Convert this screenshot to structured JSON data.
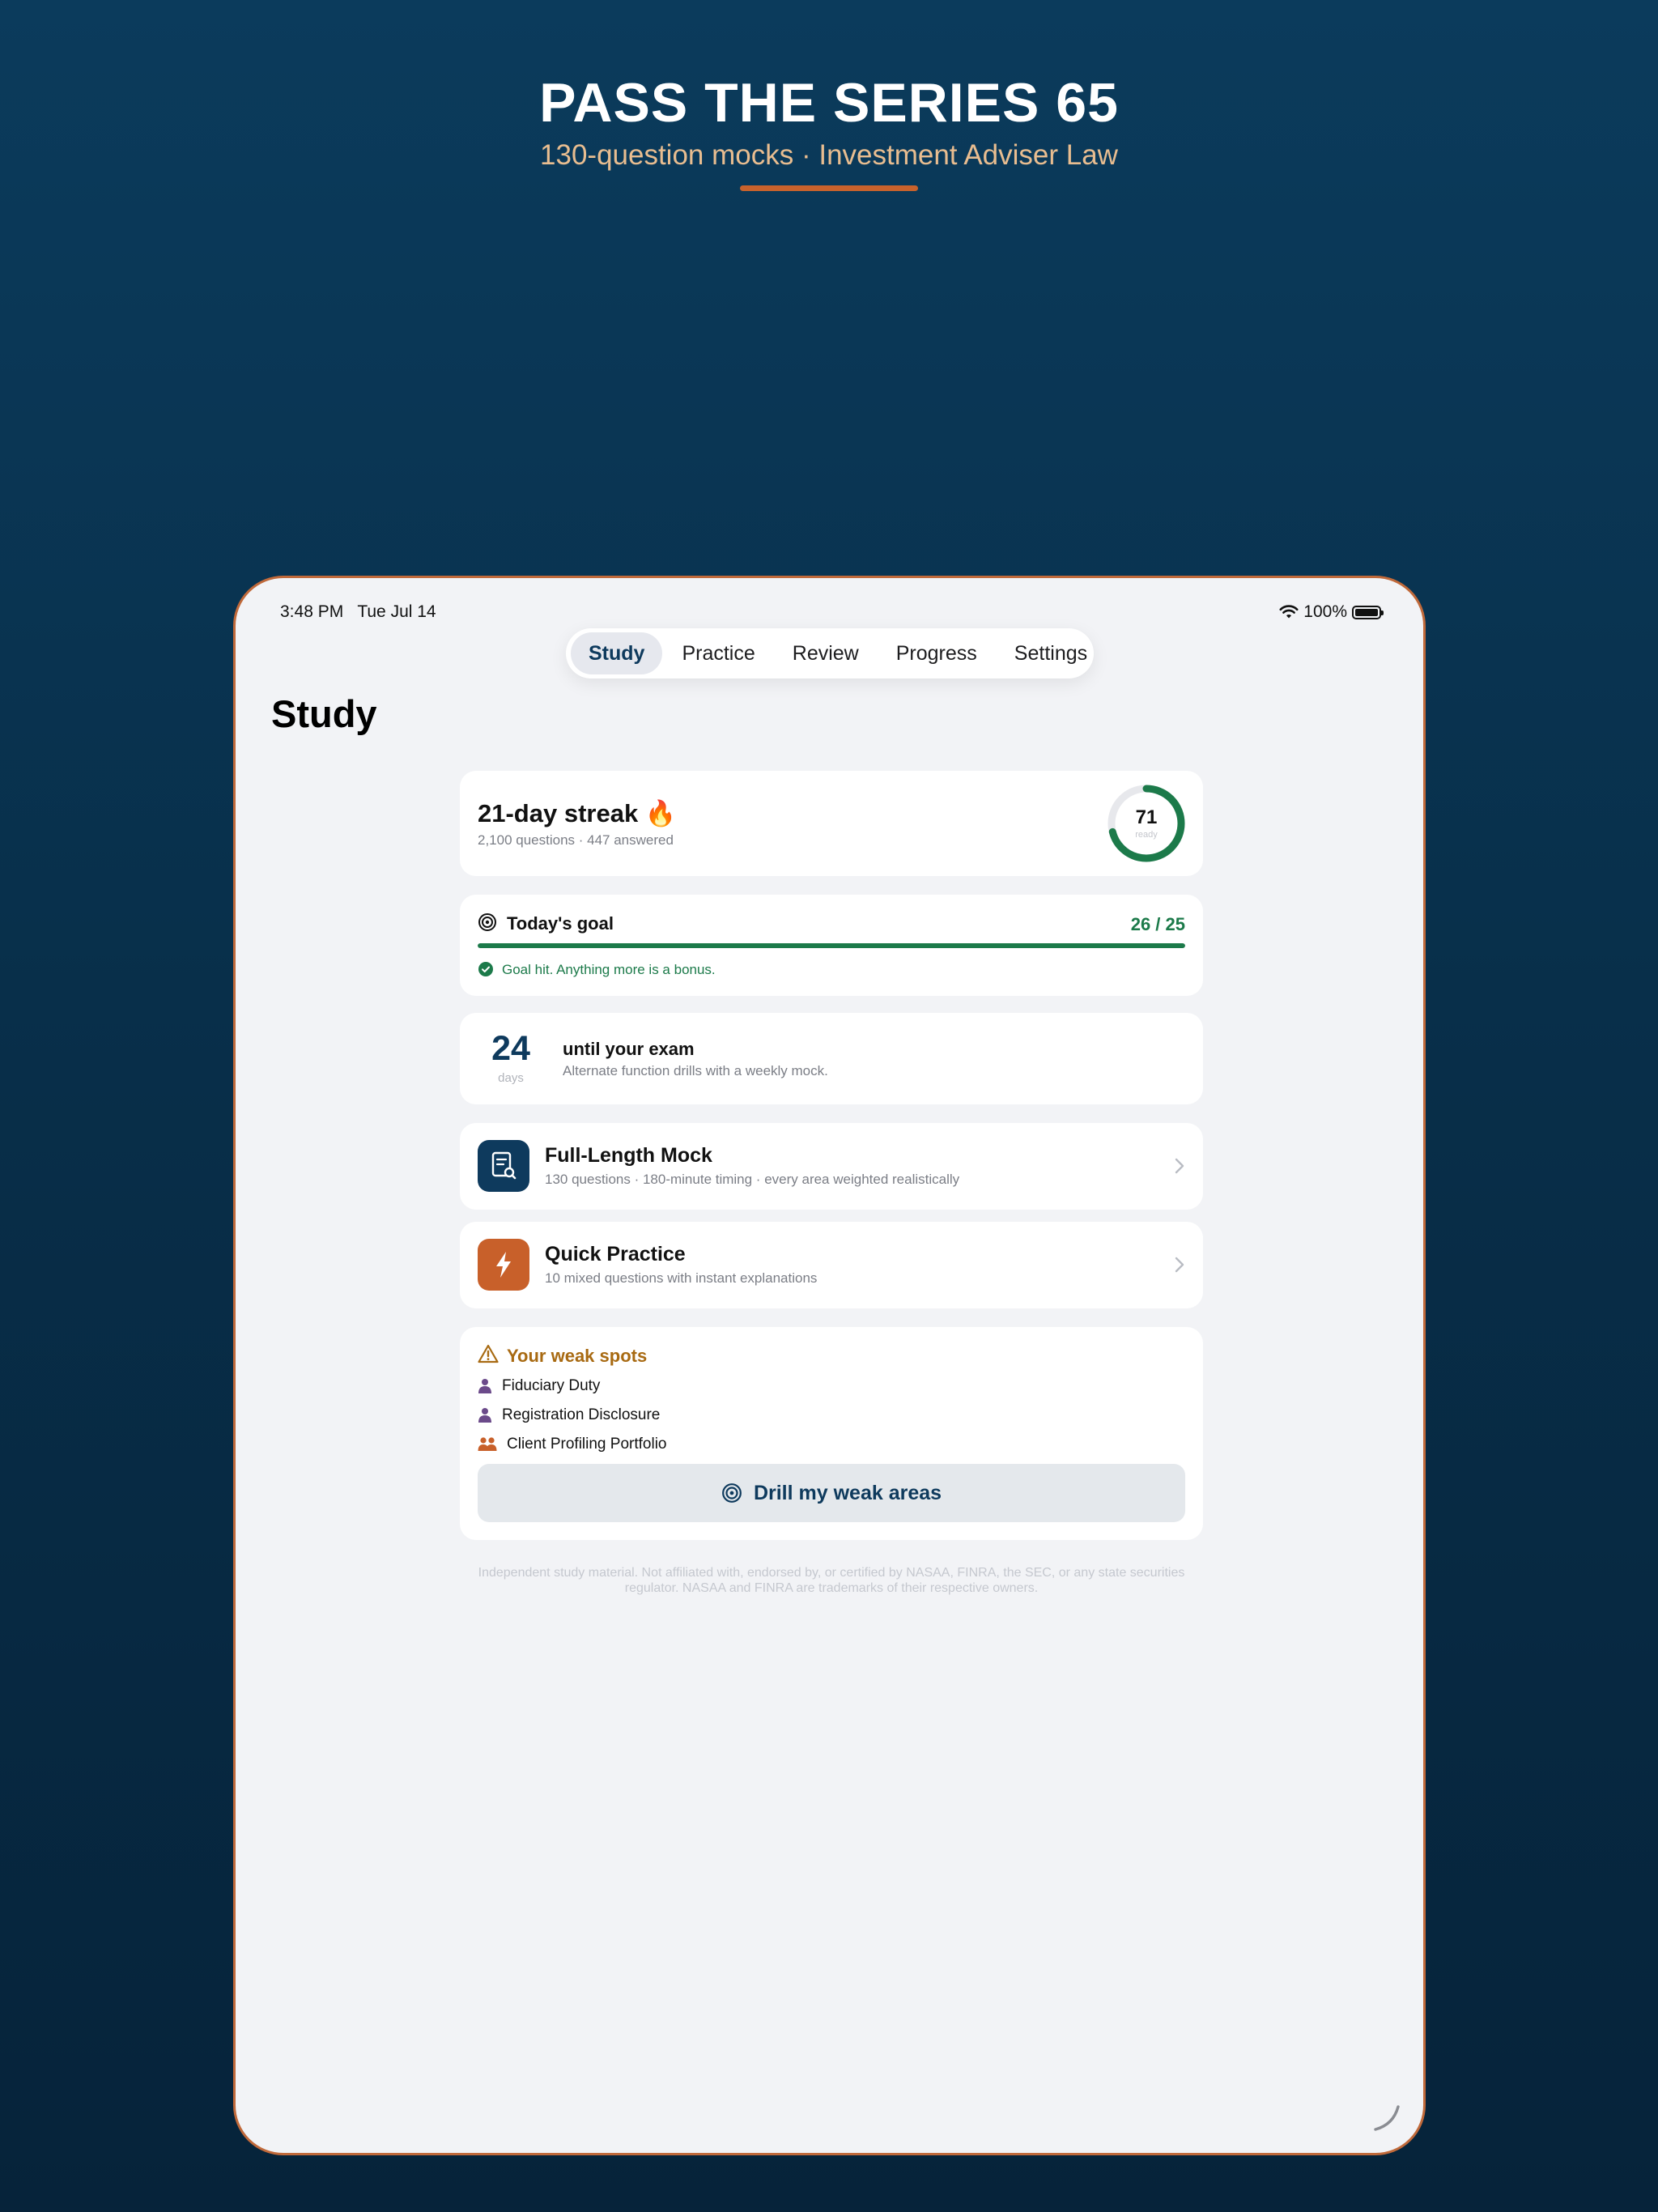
{
  "promo": {
    "title": "PASS THE SERIES 65",
    "subtitle": "130-question mocks · Investment Adviser Law"
  },
  "status_bar": {
    "time": "3:48 PM   Tue Jul 14",
    "battery": "100%"
  },
  "tabs": [
    {
      "label": "Study",
      "active": true
    },
    {
      "label": "Practice",
      "active": false
    },
    {
      "label": "Review",
      "active": false
    },
    {
      "label": "Progress",
      "active": false
    },
    {
      "label": "Settings",
      "active": false
    }
  ],
  "page_title": "Study",
  "streak": {
    "title": "21-day streak 🔥",
    "subtitle": "2,100 questions · 447 answered",
    "readiness_value": "71",
    "readiness_label": "ready",
    "readiness_fraction": 0.71
  },
  "goal": {
    "title": "Today's goal",
    "count": "26 / 25",
    "progress_fraction": 1.0,
    "note": "Goal hit. Anything more is a bonus."
  },
  "exam": {
    "days": "24",
    "unit": "days",
    "title": "until your exam",
    "subtitle": "Alternate function drills with a weekly mock."
  },
  "actions": {
    "mock": {
      "title": "Full-Length Mock",
      "subtitle": "130 questions · 180-minute timing · every area weighted realistically",
      "icon": "exam-document-icon"
    },
    "quick": {
      "title": "Quick Practice",
      "subtitle": "10 mixed questions with instant explanations",
      "icon": "lightning-icon"
    }
  },
  "weak_spots": {
    "title": "Your weak spots",
    "items": [
      {
        "label": "Fiduciary Duty",
        "icon": "person-icon"
      },
      {
        "label": "Registration Disclosure",
        "icon": "person-icon"
      },
      {
        "label": "Client Profiling Portfolio",
        "icon": "people-icon"
      }
    ],
    "button_label": "Drill my weak areas"
  },
  "disclaimer": "Independent study material. Not affiliated with, endorsed by, or certified by NASAA, FINRA, the SEC, or any state securities regulator. NASAA and FINRA are trademarks of their respective owners.",
  "colors": {
    "navy": "#0e3a5d",
    "accent_orange": "#c8602a",
    "success_green": "#1c7a4a",
    "warning_amber": "#a86a12",
    "weak_person_purple": "#6b4a8a"
  }
}
